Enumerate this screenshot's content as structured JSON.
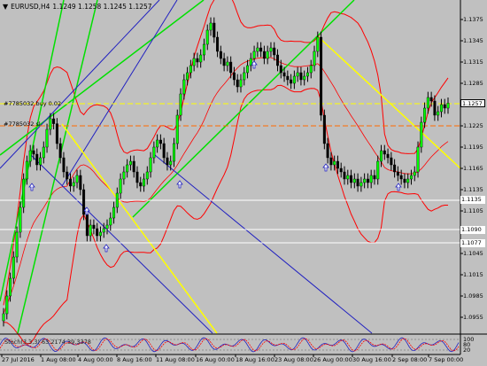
{
  "header": {
    "symbol": "EURUSD,H4",
    "ohlc": "1.1249 1.1258 1.1245 1.1257"
  },
  "orders": [
    {
      "label": "#7785032 buy 0.02",
      "y": 1.126
    },
    {
      "label": "#7785032 sl",
      "y": 1.1227
    }
  ],
  "price_axis": [
    "1.1375",
    "1.1345",
    "1.1315",
    "1.1285",
    "1.1255",
    "1.1225",
    "1.1195",
    "1.1165",
    "1.1135",
    "1.1105",
    "1.1075",
    "1.1045",
    "1.1015",
    "1.0985",
    "1.0955"
  ],
  "price_tags": [
    {
      "text": "1.1257",
      "style": "current"
    },
    {
      "text": "1.1135",
      "style": "white"
    },
    {
      "text": "1.1090",
      "style": "white"
    },
    {
      "text": "1.1077",
      "style": "white"
    }
  ],
  "time_axis": [
    "27 Jul 2016",
    "1 Aug 08:00",
    "4 Aug 00:00",
    "8 Aug 16:00",
    "11 Aug 08:00",
    "16 Aug 00:00",
    "18 Aug 16:00",
    "23 Aug 08:00",
    "26 Aug 00:00",
    "30 Aug 16:00",
    "2 Sep 08:00",
    "7 Sep 00:00"
  ],
  "oscillator": {
    "title": "Stoch(3,3,3) 63.2174 39.3378",
    "levels": [
      "100",
      "80",
      "20",
      "0"
    ]
  },
  "colors": {
    "background": "#c0c0c0",
    "bull_candle": "#00ff00",
    "bear_candle": "#000000",
    "bands": "#ff0000",
    "trend_yellow": "#ffff00",
    "trend_green": "#00e000",
    "trend_blue": "#2020c0"
  },
  "chart_data": {
    "type": "candlestick",
    "ylim": [
      1.094,
      1.1395
    ],
    "closes": [
      1.096,
      1.0985,
      1.101,
      1.104,
      1.1075,
      1.111,
      1.115,
      1.1175,
      1.119,
      1.1185,
      1.117,
      1.118,
      1.1195,
      1.122,
      1.1235,
      1.1228,
      1.12,
      1.118,
      1.116,
      1.115,
      1.114,
      1.1145,
      1.1155,
      1.1135,
      1.11,
      1.107,
      1.1085,
      1.108,
      1.107,
      1.1075,
      1.108,
      1.1085,
      1.1095,
      1.111,
      1.113,
      1.115,
      1.116,
      1.117,
      1.1175,
      1.116,
      1.1145,
      1.114,
      1.115,
      1.116,
      1.118,
      1.1195,
      1.1205,
      1.12,
      1.118,
      1.117,
      1.1175,
      1.12,
      1.124,
      1.127,
      1.129,
      1.13,
      1.131,
      1.132,
      1.1315,
      1.1325,
      1.134,
      1.136,
      1.137,
      1.135,
      1.133,
      1.132,
      1.131,
      1.1315,
      1.13,
      1.129,
      1.128,
      1.129,
      1.13,
      1.131,
      1.132,
      1.133,
      1.1335,
      1.133,
      1.132,
      1.133,
      1.1335,
      1.1325,
      1.131,
      1.13,
      1.1295,
      1.129,
      1.1285,
      1.1295,
      1.13,
      1.129,
      1.1295,
      1.13,
      1.131,
      1.133,
      1.135,
      1.124,
      1.12,
      1.118,
      1.117,
      1.1175,
      1.1165,
      1.116,
      1.115,
      1.1155,
      1.1145,
      1.115,
      1.114,
      1.1145,
      1.115,
      1.1145,
      1.1155,
      1.115,
      1.1175,
      1.119,
      1.1185,
      1.118,
      1.117,
      1.116,
      1.1155,
      1.115,
      1.1145,
      1.115,
      1.1155,
      1.116,
      1.1195,
      1.123,
      1.125,
      1.1265,
      1.126,
      1.124,
      1.1245,
      1.1255,
      1.125,
      1.1257
    ]
  }
}
